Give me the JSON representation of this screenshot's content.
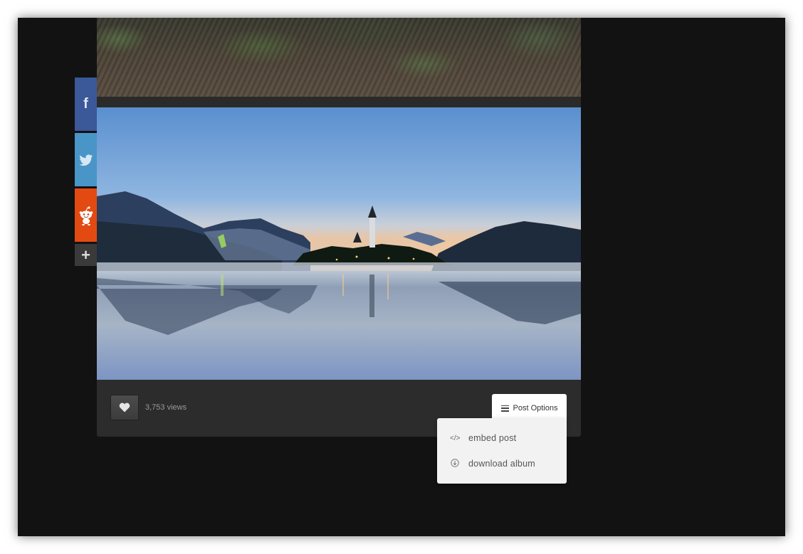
{
  "social": {
    "facebook_icon": "f",
    "more_icon": "+"
  },
  "post": {
    "views": "3,753 views",
    "options_label": "Post Options"
  },
  "dropdown": {
    "items": [
      {
        "icon": "</>",
        "label": "embed post"
      },
      {
        "icon": "↓",
        "label": "download album"
      }
    ]
  },
  "colors": {
    "facebook": "#3b5898",
    "twitter": "#4a95c8",
    "reddit": "#e24a12",
    "background": "#121212"
  }
}
